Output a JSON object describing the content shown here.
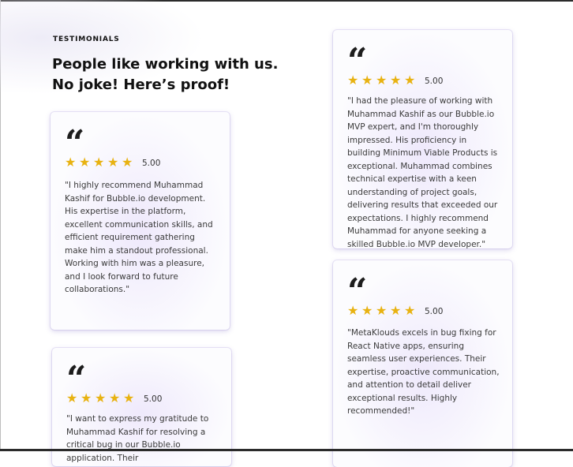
{
  "section": {
    "eyebrow": "TESTIMONIALS",
    "heading_line1": "People like working with us.",
    "heading_line2": "No joke! Here’s proof!"
  },
  "quote_glyph": "“",
  "star_glyph": "★",
  "colors": {
    "star": "#e8b211",
    "card_glow": "#eee8fc"
  },
  "testimonials": [
    {
      "stars": 5,
      "rating": "5.00",
      "text": "\"I highly recommend Muhammad Kashif for Bubble.io development. His expertise in the platform, excellent communication skills, and efficient requirement gathering make him a standout professional. Working with him was a pleasure, and I look forward to future collaborations.\""
    },
    {
      "stars": 5,
      "rating": "5.00",
      "text": "\"I want to express my gratitude to Muhammad Kashif for resolving a critical bug in our Bubble.io application. Their"
    },
    {
      "stars": 5,
      "rating": "5.00",
      "text": "\"I had the pleasure of working with Muhammad Kashif as our Bubble.io MVP expert, and I'm thoroughly impressed. His proficiency in building Minimum Viable Products is exceptional. Muhammad combines technical expertise with a keen understanding of project goals, delivering results that exceeded our expectations. I highly recommend Muhammad for anyone seeking a skilled Bubble.io MVP developer.\""
    },
    {
      "stars": 5,
      "rating": "5.00",
      "text": "\"MetaKlouds excels in bug fixing for React Native apps, ensuring seamless user experiences. Their expertise, proactive communication, and attention to detail deliver exceptional results. Highly recommended!\""
    }
  ]
}
